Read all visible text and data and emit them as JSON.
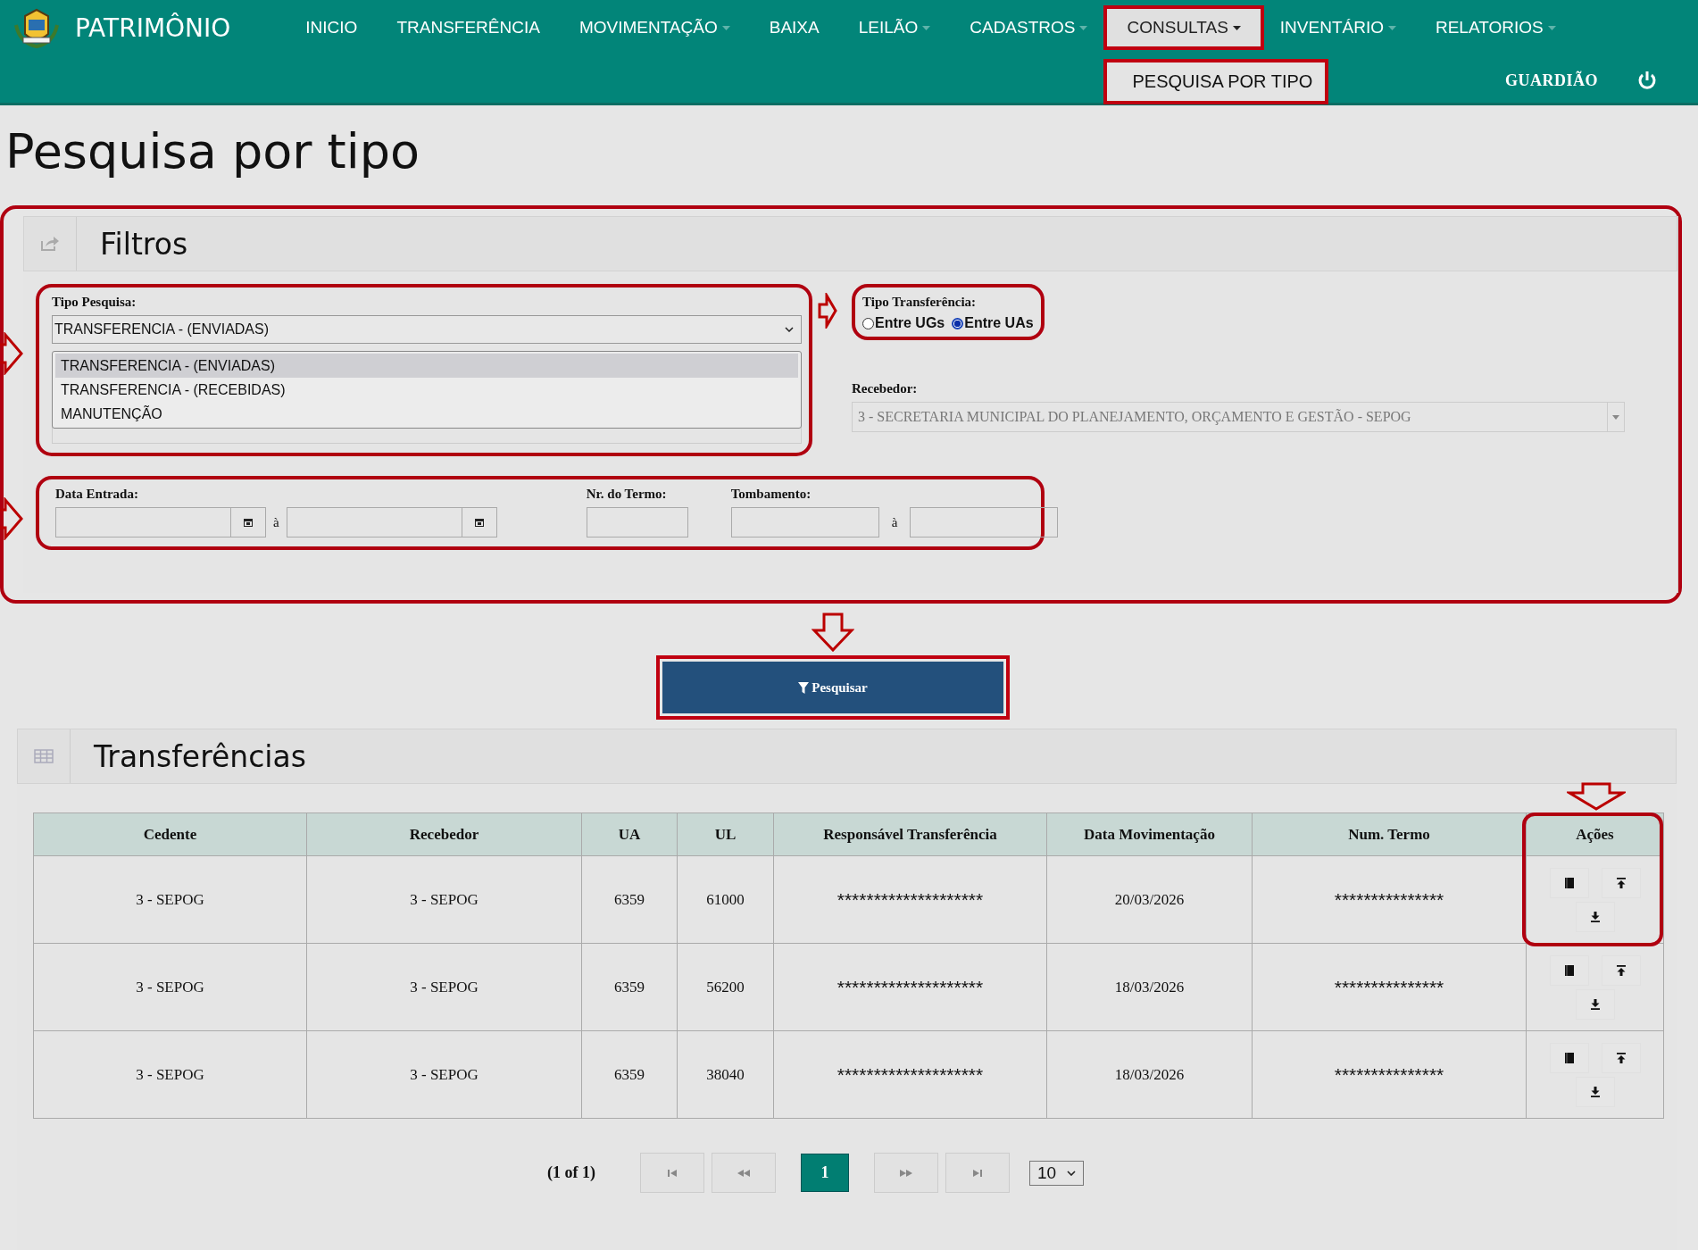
{
  "header": {
    "title": "PATRIMÔNIO",
    "nav": [
      {
        "label": "INICIO",
        "has_menu": false,
        "selected": false,
        "highlighted": false
      },
      {
        "label": "TRANSFERÊNCIA",
        "has_menu": false,
        "selected": false,
        "highlighted": false
      },
      {
        "label": "MOVIMENTAÇÃO",
        "has_menu": true,
        "selected": false,
        "highlighted": false
      },
      {
        "label": "BAIXA",
        "has_menu": false,
        "selected": false,
        "highlighted": false
      },
      {
        "label": "LEILÃO",
        "has_menu": true,
        "selected": false,
        "highlighted": false
      },
      {
        "label": "CADASTROS",
        "has_menu": true,
        "selected": false,
        "highlighted": false
      },
      {
        "label": "CONSULTAS",
        "has_menu": true,
        "selected": true,
        "highlighted": true
      },
      {
        "label": "INVENTÁRIO",
        "has_menu": true,
        "selected": false,
        "highlighted": false
      },
      {
        "label": "RELATORIOS",
        "has_menu": true,
        "selected": false,
        "highlighted": false
      }
    ],
    "submenu": [
      {
        "label": "PESQUISA POR TIPO",
        "highlighted": true
      }
    ],
    "user": "GUARDIÃO"
  },
  "page_title": "Pesquisa por tipo",
  "filters": {
    "title": "Filtros",
    "highlighted": true,
    "tipo_pesquisa": {
      "label": "Tipo Pesquisa:",
      "value": "TRANSFERENCIA - (ENVIADAS)",
      "expanded": true,
      "highlighted": true,
      "options": [
        {
          "label": "TRANSFERENCIA - (ENVIADAS)",
          "selected": true
        },
        {
          "label": "TRANSFERENCIA - (RECEBIDAS)",
          "selected": false
        },
        {
          "label": "MANUTENÇÃO",
          "selected": false
        }
      ]
    },
    "tipo_transferencia": {
      "label": "Tipo Transferência:",
      "highlighted": true,
      "options": [
        {
          "label": "Entre UGs",
          "selected": false
        },
        {
          "label": "Entre UAs",
          "selected": true
        }
      ]
    },
    "recebedor": {
      "label": "Recebedor:",
      "value": "3 - SECRETARIA MUNICIPAL DO PLANEJAMENTO, ORÇAMENTO E GESTÃO - SEPOG",
      "disabled": true
    },
    "dates_group": {
      "highlighted": true,
      "data_entrada": {
        "label": "Data Entrada:",
        "separator": "à"
      },
      "nr_termo": {
        "label": "Nr. do Termo:"
      },
      "tombamento": {
        "label": "Tombamento:",
        "separator": "à"
      }
    }
  },
  "search_button": {
    "label": "Pesquisar",
    "highlighted": true
  },
  "results": {
    "title": "Transferências",
    "table": {
      "columns": [
        "Cedente",
        "Recebedor",
        "UA",
        "UL",
        "Responsável Transferência",
        "Data Movimentação",
        "Num. Termo",
        "Ações"
      ],
      "actions_highlighted": true,
      "rows": [
        {
          "cells": [
            "3 - SEPOG",
            "3 - SEPOG",
            "6359",
            "61000",
            "********************",
            "20/03/2026",
            "***************"
          ]
        },
        {
          "cells": [
            "3 - SEPOG",
            "3 - SEPOG",
            "6359",
            "56200",
            "********************",
            "18/03/2026",
            "***************"
          ]
        },
        {
          "cells": [
            "3 - SEPOG",
            "3 - SEPOG",
            "6359",
            "38040",
            "********************",
            "18/03/2026",
            "***************"
          ]
        }
      ]
    },
    "pagination": {
      "summary": "(1 of 1)",
      "pages": [
        {
          "label": "1",
          "selected": true
        }
      ],
      "page_size": "10"
    }
  }
}
